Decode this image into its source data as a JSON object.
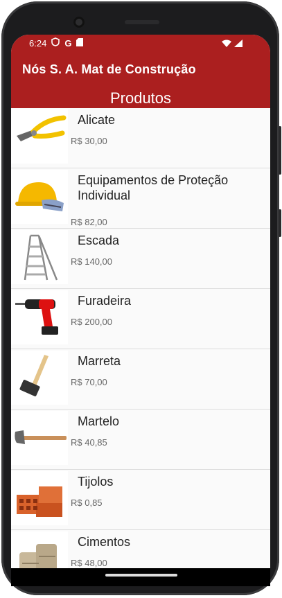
{
  "status": {
    "time": "6:24",
    "icons": [
      "shield-icon",
      "google-icon",
      "sd-card-icon",
      "wifi-icon",
      "signal-icon"
    ]
  },
  "appbar": {
    "title": "Nós S. A. Mat de Construção"
  },
  "section": {
    "title": "Produtos"
  },
  "products": [
    {
      "name": "Alicate",
      "price": "R$ 30,00",
      "icon": "pliers-icon"
    },
    {
      "name": "Equipamentos de Proteção Individual",
      "price": "R$ 82,00",
      "icon": "helmet-icon"
    },
    {
      "name": "Escada",
      "price": "R$ 140,00",
      "icon": "ladder-icon"
    },
    {
      "name": "Furadeira",
      "price": "R$ 200,00",
      "icon": "drill-icon"
    },
    {
      "name": "Marreta",
      "price": "R$ 70,00",
      "icon": "sledgehammer-icon"
    },
    {
      "name": "Martelo",
      "price": "R$ 40,85",
      "icon": "hammer-icon"
    },
    {
      "name": "Tijolos",
      "price": "R$ 0,85",
      "icon": "bricks-icon"
    },
    {
      "name": "Cimentos",
      "price": "R$ 48,00",
      "icon": "cement-bags-icon"
    }
  ],
  "colors": {
    "primary": "#ab1f1f",
    "background": "#fafafa"
  }
}
